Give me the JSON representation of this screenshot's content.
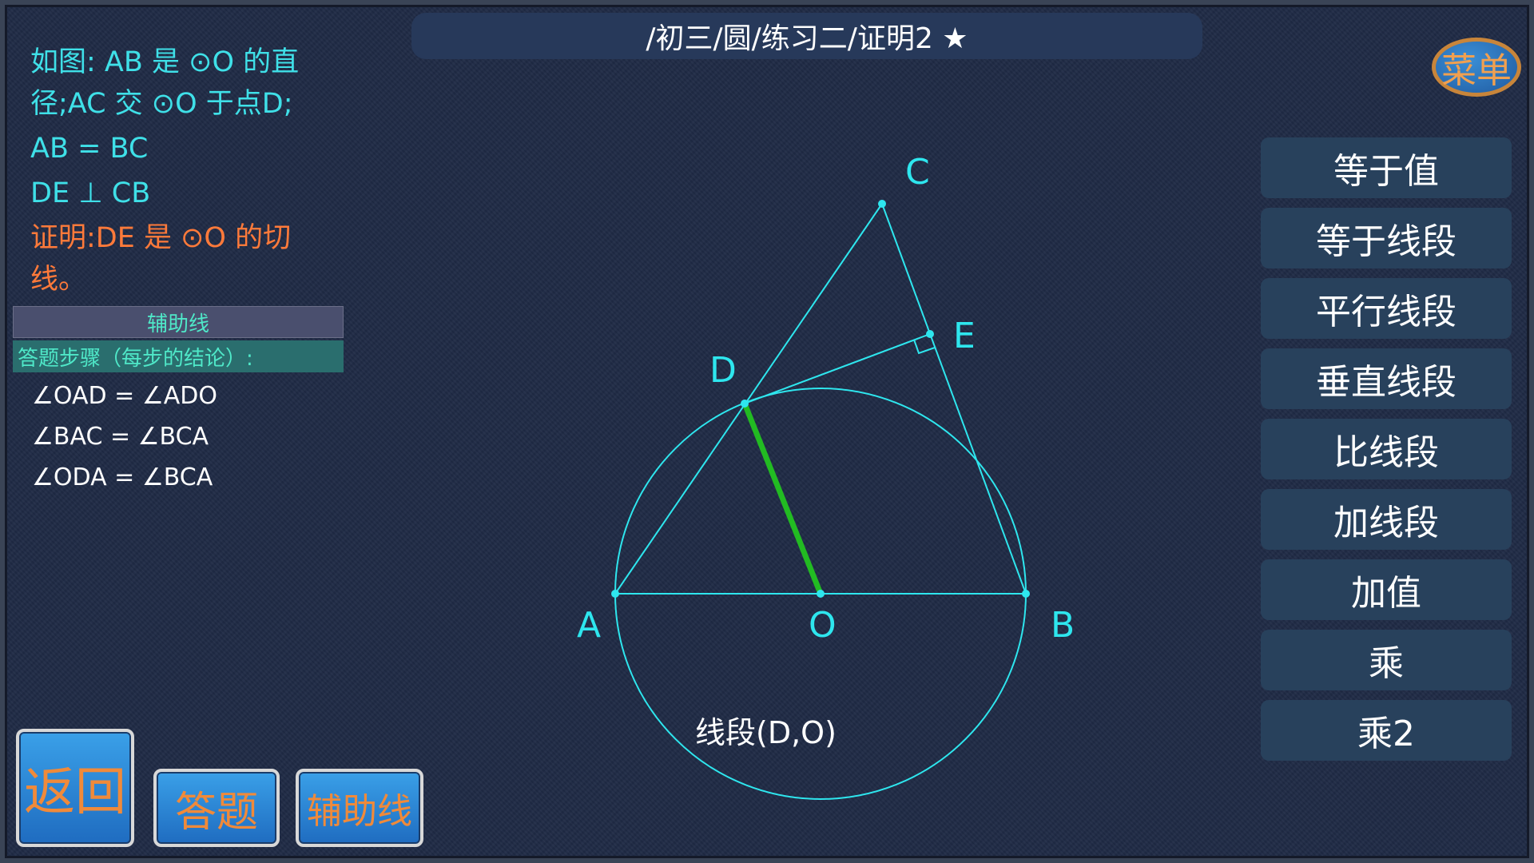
{
  "header": {
    "title": "/初三/圆/练习二/证明2 ★"
  },
  "menu": {
    "label": "菜单"
  },
  "problem": {
    "given": "如图: AB 是 ⊙O 的直径;AC 交 ⊙O 于点D;",
    "conditions": [
      "AB = BC",
      "DE ⊥ CB"
    ],
    "prove": "证明:DE 是 ⊙O 的切线。"
  },
  "aux_line_label": "辅助线",
  "steps_header": "答题步骤（每步的结论）:",
  "steps": [
    "∠OAD = ∠ADO",
    "∠BAC = ∠BCA",
    "∠ODA = ∠BCA"
  ],
  "side_buttons": [
    "等于值",
    "等于线段",
    "平行线段",
    "垂直线段",
    "比线段",
    "加线段",
    "加值",
    "乘",
    "乘2"
  ],
  "bottom_buttons": {
    "back": "返回",
    "answer": "答题",
    "aux": "辅助线"
  },
  "figure": {
    "labels": {
      "A": "A",
      "B": "B",
      "C": "C",
      "D": "D",
      "E": "E",
      "O": "O"
    },
    "selection_label": "线段(D,O)",
    "colors": {
      "lines": "#2ee6ee",
      "highlight": "#22bb22",
      "label": "#2ee6ee"
    }
  }
}
